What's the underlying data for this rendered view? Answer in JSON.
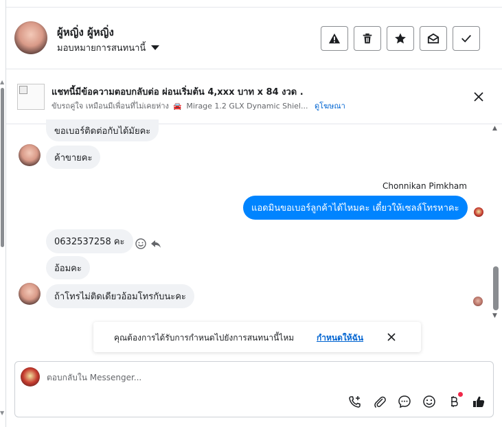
{
  "header": {
    "name": "ผู้หญิ่ง ผู้หญิ่ง",
    "assign_label": "มอบหมายการสนทนานี้",
    "buttons": [
      {
        "icon": "warning-icon"
      },
      {
        "icon": "trash-icon"
      },
      {
        "icon": "star-icon"
      },
      {
        "icon": "mark-unread-icon"
      },
      {
        "icon": "check-icon"
      }
    ]
  },
  "ad": {
    "title": "แชทนี้มีข้อความตอบกลับต่อ ผ่อนเริ่มต้น 4,xxx บาท x 84 งวด .",
    "subtitle": "ขับรถคู่ใจ เหมือนมีเพื่อนที่ไม่เคยห่าง",
    "car_emoji": "🚘",
    "subtitle2": "Mirage 1.2 GLX Dynamic Shiel...",
    "link": "ดูโฆษณา"
  },
  "messages": {
    "m1": "ขอเบอร์ติดต่อกับได้มัยคะ",
    "m2": "ค้าขายคะ",
    "sender": "Chonnikan Pimkham",
    "m3": "แอดมินขอเบอร์ลูกค้าได้ไหมคะ เดี๋ยวให้เซลล์โทรหาคะ",
    "m4": "0632537258 คะ",
    "m5": "อ้อมคะ",
    "m6": "ถ้าโทรไม่ติดเดียวอ้อมโทรกับนะคะ"
  },
  "assign_banner": {
    "text": "คุณต้องการได้รับการกำหนดไปยังการสนทนานี้ไหม",
    "link": "กำหนดให้ฉัน"
  },
  "composer": {
    "placeholder": "ตอบกลับใน Messenger..."
  },
  "colors": {
    "outgoing_bubble": "#0084ff",
    "incoming_bubble": "#f0f2f5",
    "link": "#0064d1",
    "notification_dot": "#f02849"
  }
}
